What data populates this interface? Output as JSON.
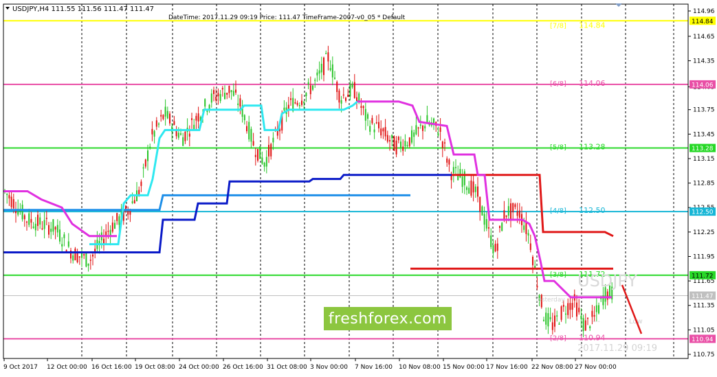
{
  "header": {
    "symbol_line": "USDJPY,H4  111.55 111.56 111.47 111.47",
    "info_line": "DateTime: 2017.11.29 09:19    Price: 111.47    TimeFrame-2007-v0_05    *    Default"
  },
  "overlay": {
    "big_symbol": "USDJPY",
    "big_time": "2017.11.29 09:19",
    "watermark": "freshforex.com",
    "yesterday_label": "Yesterday",
    "low_label": "Low",
    "dash_label": "---"
  },
  "chart_data": {
    "type": "candlestick",
    "title": "USDJPY,H4",
    "ylim": [
      110.72,
      114.96
    ],
    "y_ticks": [
      "114.96",
      "114.65",
      "114.35",
      "114.03",
      "113.75",
      "113.45",
      "113.15",
      "112.85",
      "112.55",
      "112.25",
      "111.95",
      "111.65",
      "111.35",
      "111.05",
      "110.75"
    ],
    "x_ticks": [
      "9 Oct 2017",
      "12 Oct 00:00",
      "16 Oct 16:00",
      "19 Oct 08:00",
      "24 Oct 00:00",
      "26 Oct 16:00",
      "31 Oct 08:00",
      "3 Nov 00:00",
      "7 Nov 16:00",
      "10 Nov 08:00",
      "15 Nov 00:00",
      "17 Nov 16:00",
      "22 Nov 08:00",
      "27 Nov 00:00"
    ],
    "murrey_levels": [
      {
        "name": "[7/8]",
        "value": 114.84,
        "label": "114.84",
        "color": "#ffff00"
      },
      {
        "name": "[6/8]",
        "value": 114.06,
        "label": "114.06",
        "color": "#e94fa6"
      },
      {
        "name": "[5/8]",
        "value": 113.28,
        "label": "113.28",
        "color": "#27d827"
      },
      {
        "name": "[4/8]",
        "value": 112.5,
        "label": "112.50",
        "color": "#17b6d6"
      },
      {
        "name": "[3/8]",
        "value": 111.72,
        "label": "111.72",
        "color": "#27d827"
      },
      {
        "name": "[2/8]",
        "value": 110.94,
        "label": "110.94",
        "color": "#e94fa6"
      }
    ],
    "current_price": {
      "value": 111.47,
      "label": "111.47"
    },
    "price_boxes": [
      "114.84",
      "114.06",
      "113.28",
      "112.50",
      "111.72",
      "111.47",
      "110.94"
    ],
    "colors": {
      "bull": "#27c427",
      "bear": "#e01010",
      "cyan_line": "#2ee8f0",
      "magenta_line": "#e030e0",
      "blue_dark": "#0a1ac8",
      "blue_light": "#1e8fe8",
      "red_level": "#e01818"
    }
  }
}
